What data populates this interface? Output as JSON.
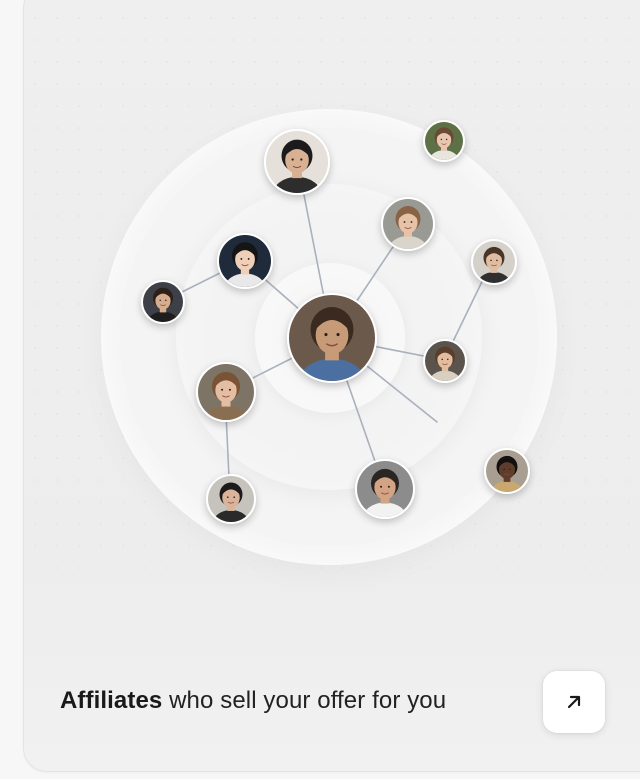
{
  "card": {
    "title_bold": "Affiliates",
    "title_rest": " who sell your offer for you",
    "action_icon": "arrow-up-right-icon"
  },
  "network": {
    "center": {
      "name": "center-affiliate-avatar",
      "skin": "#c79a78",
      "hair": "#3b2a20",
      "bg": "#6b5a4c",
      "shirt": "#4a6fa0"
    },
    "nodes": [
      {
        "name": "affiliate-avatar-1",
        "skin": "#d8b193",
        "hair": "#1b1b1b",
        "bg": "#e6e0da",
        "shirt": "#2d2d2d"
      },
      {
        "name": "affiliate-avatar-2",
        "skin": "#e8c6b0",
        "hair": "#6b4a33",
        "bg": "#5d7046",
        "shirt": "#e8e4de"
      },
      {
        "name": "affiliate-avatar-3",
        "skin": "#e6c2a6",
        "hair": "#8a6246",
        "bg": "#9a9a94",
        "shirt": "#d9d4cc"
      },
      {
        "name": "affiliate-avatar-4",
        "skin": "#efcfb8",
        "hair": "#151515",
        "bg": "#1f2b3a",
        "shirt": "#e8e8e8"
      },
      {
        "name": "affiliate-avatar-5",
        "skin": "#e0bca0",
        "hair": "#4a3426",
        "bg": "#d4d0ca",
        "shirt": "#2f2f2f"
      },
      {
        "name": "affiliate-avatar-6",
        "skin": "#d6ad8e",
        "hair": "#2c2018",
        "bg": "#3d4147",
        "shirt": "#1e1e1e"
      },
      {
        "name": "affiliate-avatar-7",
        "skin": "#e4bea2",
        "hair": "#7a5236",
        "bg": "#7d7466",
        "shirt": "#8a6e52"
      },
      {
        "name": "affiliate-avatar-8",
        "skin": "#e2bd9f",
        "hair": "#5a3e2a",
        "bg": "#5a544c",
        "shirt": "#d8cfc2"
      },
      {
        "name": "affiliate-avatar-9",
        "skin": "#d3a483",
        "hair": "#2a2624",
        "bg": "#8c8c8c",
        "shirt": "#f2f2f2"
      },
      {
        "name": "affiliate-avatar-10",
        "skin": "#d9b49a",
        "hair": "#1d1a1a",
        "bg": "#c6c3bd",
        "shirt": "#2a2a2a"
      },
      {
        "name": "affiliate-avatar-11",
        "skin": "#5e3d2c",
        "hair": "#141010",
        "bg": "#a89f92",
        "shirt": "#c8a86e"
      }
    ]
  }
}
